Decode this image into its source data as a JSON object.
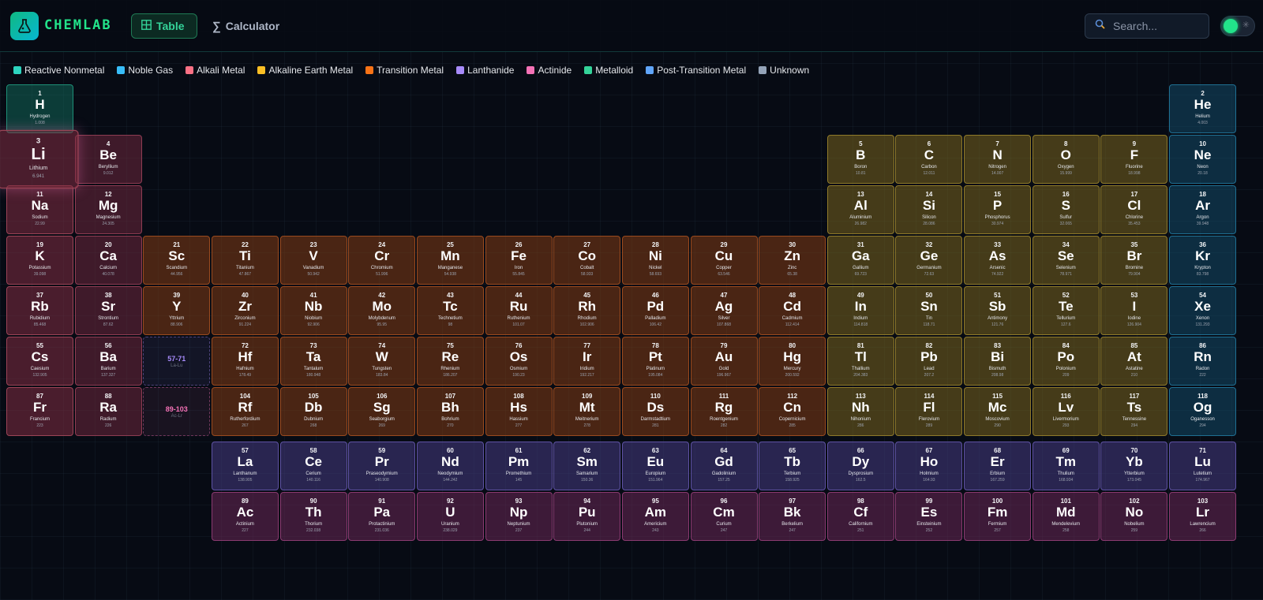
{
  "header": {
    "brand": "CHEMLAB",
    "nav": [
      {
        "label": "Table",
        "icon": "table-grid-icon",
        "active": true
      },
      {
        "label": "Calculator",
        "icon": "sigma-icon",
        "active": false
      }
    ],
    "search": {
      "placeholder": "Search...",
      "value": ""
    },
    "theme_toggle": {
      "state": "on"
    }
  },
  "legend": [
    {
      "label": "Reactive Nonmetal",
      "color": "#2dd4bf"
    },
    {
      "label": "Noble Gas",
      "color": "#38bdf8"
    },
    {
      "label": "Alkali Metal",
      "color": "#fb7185"
    },
    {
      "label": "Alkaline Earth Metal",
      "color": "#fbbf24"
    },
    {
      "label": "Transition Metal",
      "color": "#f97316"
    },
    {
      "label": "Lanthanide",
      "color": "#a78bfa"
    },
    {
      "label": "Actinide",
      "color": "#f472b6"
    },
    {
      "label": "Metalloid",
      "color": "#34d399"
    },
    {
      "label": "Post-Transition Metal",
      "color": "#60a5fa"
    },
    {
      "label": "Unknown",
      "color": "#94a3b8"
    }
  ],
  "selected_element": "Li",
  "placeholders": [
    {
      "range": "57-71",
      "label": "La-Lu",
      "color": "#a78bfa",
      "row": 6,
      "col": 3
    },
    {
      "range": "89-103",
      "label": "Ac-Lr",
      "color": "#f472b6",
      "row": 7,
      "col": 3
    }
  ],
  "elements": [
    {
      "n": 1,
      "s": "H",
      "name": "Hydrogen",
      "w": "1.008",
      "c": "rn",
      "r": 1,
      "col": 1
    },
    {
      "n": 2,
      "s": "He",
      "name": "Helium",
      "w": "4.003",
      "c": "ng",
      "r": 1,
      "col": 18
    },
    {
      "n": 3,
      "s": "Li",
      "name": "Lithium",
      "w": "6.941",
      "c": "am",
      "r": 2,
      "col": 1
    },
    {
      "n": 4,
      "s": "Be",
      "name": "Beryllium",
      "w": "9.012",
      "c": "ae",
      "r": 2,
      "col": 2
    },
    {
      "n": 5,
      "s": "B",
      "name": "Boron",
      "w": "10.81",
      "c": "md",
      "r": 2,
      "col": 13
    },
    {
      "n": 6,
      "s": "C",
      "name": "Carbon",
      "w": "12.011",
      "c": "rn2",
      "r": 2,
      "col": 14
    },
    {
      "n": 7,
      "s": "N",
      "name": "Nitrogen",
      "w": "14.007",
      "c": "rn2",
      "r": 2,
      "col": 15
    },
    {
      "n": 8,
      "s": "O",
      "name": "Oxygen",
      "w": "15.999",
      "c": "rn2",
      "r": 2,
      "col": 16
    },
    {
      "n": 9,
      "s": "F",
      "name": "Fluorine",
      "w": "18.998",
      "c": "rn2",
      "r": 2,
      "col": 17
    },
    {
      "n": 10,
      "s": "Ne",
      "name": "Neon",
      "w": "20.18",
      "c": "ng",
      "r": 2,
      "col": 18
    },
    {
      "n": 11,
      "s": "Na",
      "name": "Sodium",
      "w": "22.99",
      "c": "am",
      "r": 3,
      "col": 1
    },
    {
      "n": 12,
      "s": "Mg",
      "name": "Magnesium",
      "w": "24.305",
      "c": "ae",
      "r": 3,
      "col": 2
    },
    {
      "n": 13,
      "s": "Al",
      "name": "Aluminium",
      "w": "26.982",
      "c": "pt",
      "r": 3,
      "col": 13
    },
    {
      "n": 14,
      "s": "Si",
      "name": "Silicon",
      "w": "28.086",
      "c": "md",
      "r": 3,
      "col": 14
    },
    {
      "n": 15,
      "s": "P",
      "name": "Phosphorus",
      "w": "30.974",
      "c": "rn2",
      "r": 3,
      "col": 15
    },
    {
      "n": 16,
      "s": "S",
      "name": "Sulfur",
      "w": "32.065",
      "c": "rn2",
      "r": 3,
      "col": 16
    },
    {
      "n": 17,
      "s": "Cl",
      "name": "Chlorine",
      "w": "35.453",
      "c": "rn2",
      "r": 3,
      "col": 17
    },
    {
      "n": 18,
      "s": "Ar",
      "name": "Argon",
      "w": "39.948",
      "c": "ng",
      "r": 3,
      "col": 18
    },
    {
      "n": 19,
      "s": "K",
      "name": "Potassium",
      "w": "39.098",
      "c": "am",
      "r": 4,
      "col": 1
    },
    {
      "n": 20,
      "s": "Ca",
      "name": "Calcium",
      "w": "40.078",
      "c": "ae",
      "r": 4,
      "col": 2
    },
    {
      "n": 21,
      "s": "Sc",
      "name": "Scandium",
      "w": "44.956",
      "c": "tm",
      "r": 4,
      "col": 3
    },
    {
      "n": 22,
      "s": "Ti",
      "name": "Titanium",
      "w": "47.867",
      "c": "tm",
      "r": 4,
      "col": 4
    },
    {
      "n": 23,
      "s": "V",
      "name": "Vanadium",
      "w": "50.942",
      "c": "tm",
      "r": 4,
      "col": 5
    },
    {
      "n": 24,
      "s": "Cr",
      "name": "Chromium",
      "w": "51.996",
      "c": "tm",
      "r": 4,
      "col": 6
    },
    {
      "n": 25,
      "s": "Mn",
      "name": "Manganese",
      "w": "54.938",
      "c": "tm",
      "r": 4,
      "col": 7
    },
    {
      "n": 26,
      "s": "Fe",
      "name": "Iron",
      "w": "55.845",
      "c": "tm",
      "r": 4,
      "col": 8
    },
    {
      "n": 27,
      "s": "Co",
      "name": "Cobalt",
      "w": "58.933",
      "c": "tm",
      "r": 4,
      "col": 9
    },
    {
      "n": 28,
      "s": "Ni",
      "name": "Nickel",
      "w": "58.693",
      "c": "tm",
      "r": 4,
      "col": 10
    },
    {
      "n": 29,
      "s": "Cu",
      "name": "Copper",
      "w": "63.546",
      "c": "tm",
      "r": 4,
      "col": 11
    },
    {
      "n": 30,
      "s": "Zn",
      "name": "Zinc",
      "w": "65.38",
      "c": "tm",
      "r": 4,
      "col": 12
    },
    {
      "n": 31,
      "s": "Ga",
      "name": "Gallium",
      "w": "69.723",
      "c": "pt",
      "r": 4,
      "col": 13
    },
    {
      "n": 32,
      "s": "Ge",
      "name": "Germanium",
      "w": "72.63",
      "c": "md",
      "r": 4,
      "col": 14
    },
    {
      "n": 33,
      "s": "As",
      "name": "Arsenic",
      "w": "74.922",
      "c": "md",
      "r": 4,
      "col": 15
    },
    {
      "n": 34,
      "s": "Se",
      "name": "Selenium",
      "w": "78.971",
      "c": "rn2",
      "r": 4,
      "col": 16
    },
    {
      "n": 35,
      "s": "Br",
      "name": "Bromine",
      "w": "79.904",
      "c": "rn2",
      "r": 4,
      "col": 17
    },
    {
      "n": 36,
      "s": "Kr",
      "name": "Krypton",
      "w": "83.798",
      "c": "ng",
      "r": 4,
      "col": 18
    },
    {
      "n": 37,
      "s": "Rb",
      "name": "Rubidium",
      "w": "85.468",
      "c": "am",
      "r": 5,
      "col": 1
    },
    {
      "n": 38,
      "s": "Sr",
      "name": "Strontium",
      "w": "87.62",
      "c": "ae",
      "r": 5,
      "col": 2
    },
    {
      "n": 39,
      "s": "Y",
      "name": "Yttrium",
      "w": "88.906",
      "c": "tm",
      "r": 5,
      "col": 3
    },
    {
      "n": 40,
      "s": "Zr",
      "name": "Zirconium",
      "w": "91.224",
      "c": "tm",
      "r": 5,
      "col": 4
    },
    {
      "n": 41,
      "s": "Nb",
      "name": "Niobium",
      "w": "92.906",
      "c": "tm",
      "r": 5,
      "col": 5
    },
    {
      "n": 42,
      "s": "Mo",
      "name": "Molybdenum",
      "w": "95.95",
      "c": "tm",
      "r": 5,
      "col": 6
    },
    {
      "n": 43,
      "s": "Tc",
      "name": "Technetium",
      "w": "98",
      "c": "tm",
      "r": 5,
      "col": 7
    },
    {
      "n": 44,
      "s": "Ru",
      "name": "Ruthenium",
      "w": "101.07",
      "c": "tm",
      "r": 5,
      "col": 8
    },
    {
      "n": 45,
      "s": "Rh",
      "name": "Rhodium",
      "w": "102.906",
      "c": "tm",
      "r": 5,
      "col": 9
    },
    {
      "n": 46,
      "s": "Pd",
      "name": "Palladium",
      "w": "106.42",
      "c": "tm",
      "r": 5,
      "col": 10
    },
    {
      "n": 47,
      "s": "Ag",
      "name": "Silver",
      "w": "107.868",
      "c": "tm",
      "r": 5,
      "col": 11
    },
    {
      "n": 48,
      "s": "Cd",
      "name": "Cadmium",
      "w": "112.414",
      "c": "tm",
      "r": 5,
      "col": 12
    },
    {
      "n": 49,
      "s": "In",
      "name": "Indium",
      "w": "114.818",
      "c": "pt",
      "r": 5,
      "col": 13
    },
    {
      "n": 50,
      "s": "Sn",
      "name": "Tin",
      "w": "118.71",
      "c": "pt",
      "r": 5,
      "col": 14
    },
    {
      "n": 51,
      "s": "Sb",
      "name": "Antimony",
      "w": "121.76",
      "c": "md",
      "r": 5,
      "col": 15
    },
    {
      "n": 52,
      "s": "Te",
      "name": "Tellurium",
      "w": "127.6",
      "c": "md",
      "r": 5,
      "col": 16
    },
    {
      "n": 53,
      "s": "I",
      "name": "Iodine",
      "w": "126.904",
      "c": "rn2",
      "r": 5,
      "col": 17
    },
    {
      "n": 54,
      "s": "Xe",
      "name": "Xenon",
      "w": "131.293",
      "c": "ng",
      "r": 5,
      "col": 18
    },
    {
      "n": 55,
      "s": "Cs",
      "name": "Caesium",
      "w": "132.905",
      "c": "am",
      "r": 6,
      "col": 1
    },
    {
      "n": 56,
      "s": "Ba",
      "name": "Barium",
      "w": "137.327",
      "c": "ae",
      "r": 6,
      "col": 2
    },
    {
      "n": 72,
      "s": "Hf",
      "name": "Hafnium",
      "w": "178.49",
      "c": "tm",
      "r": 6,
      "col": 4
    },
    {
      "n": 73,
      "s": "Ta",
      "name": "Tantalum",
      "w": "180.948",
      "c": "tm",
      "r": 6,
      "col": 5
    },
    {
      "n": 74,
      "s": "W",
      "name": "Tungsten",
      "w": "183.84",
      "c": "tm",
      "r": 6,
      "col": 6
    },
    {
      "n": 75,
      "s": "Re",
      "name": "Rhenium",
      "w": "186.207",
      "c": "tm",
      "r": 6,
      "col": 7
    },
    {
      "n": 76,
      "s": "Os",
      "name": "Osmium",
      "w": "190.23",
      "c": "tm",
      "r": 6,
      "col": 8
    },
    {
      "n": 77,
      "s": "Ir",
      "name": "Iridium",
      "w": "192.217",
      "c": "tm",
      "r": 6,
      "col": 9
    },
    {
      "n": 78,
      "s": "Pt",
      "name": "Platinum",
      "w": "195.084",
      "c": "tm",
      "r": 6,
      "col": 10
    },
    {
      "n": 79,
      "s": "Au",
      "name": "Gold",
      "w": "196.967",
      "c": "tm",
      "r": 6,
      "col": 11
    },
    {
      "n": 80,
      "s": "Hg",
      "name": "Mercury",
      "w": "200.592",
      "c": "tm",
      "r": 6,
      "col": 12
    },
    {
      "n": 81,
      "s": "Tl",
      "name": "Thallium",
      "w": "204.383",
      "c": "pt",
      "r": 6,
      "col": 13
    },
    {
      "n": 82,
      "s": "Pb",
      "name": "Lead",
      "w": "207.2",
      "c": "pt",
      "r": 6,
      "col": 14
    },
    {
      "n": 83,
      "s": "Bi",
      "name": "Bismuth",
      "w": "208.98",
      "c": "pt",
      "r": 6,
      "col": 15
    },
    {
      "n": 84,
      "s": "Po",
      "name": "Polonium",
      "w": "209",
      "c": "pt",
      "r": 6,
      "col": 16
    },
    {
      "n": 85,
      "s": "At",
      "name": "Astatine",
      "w": "210",
      "c": "md",
      "r": 6,
      "col": 17
    },
    {
      "n": 86,
      "s": "Rn",
      "name": "Radon",
      "w": "222",
      "c": "ng",
      "r": 6,
      "col": 18
    },
    {
      "n": 87,
      "s": "Fr",
      "name": "Francium",
      "w": "223",
      "c": "am",
      "r": 7,
      "col": 1
    },
    {
      "n": 88,
      "s": "Ra",
      "name": "Radium",
      "w": "226",
      "c": "ae",
      "r": 7,
      "col": 2
    },
    {
      "n": 104,
      "s": "Rf",
      "name": "Rutherfordium",
      "w": "267",
      "c": "tm",
      "r": 7,
      "col": 4
    },
    {
      "n": 105,
      "s": "Db",
      "name": "Dubnium",
      "w": "268",
      "c": "tm",
      "r": 7,
      "col": 5
    },
    {
      "n": 106,
      "s": "Sg",
      "name": "Seaborgium",
      "w": "269",
      "c": "tm",
      "r": 7,
      "col": 6
    },
    {
      "n": 107,
      "s": "Bh",
      "name": "Bohrium",
      "w": "270",
      "c": "tm",
      "r": 7,
      "col": 7
    },
    {
      "n": 108,
      "s": "Hs",
      "name": "Hassium",
      "w": "277",
      "c": "tm",
      "r": 7,
      "col": 8
    },
    {
      "n": 109,
      "s": "Mt",
      "name": "Meitnerium",
      "w": "278",
      "c": "tm",
      "r": 7,
      "col": 9
    },
    {
      "n": 110,
      "s": "Ds",
      "name": "Darmstadtium",
      "w": "281",
      "c": "tm",
      "r": 7,
      "col": 10
    },
    {
      "n": 111,
      "s": "Rg",
      "name": "Roentgenium",
      "w": "282",
      "c": "tm",
      "r": 7,
      "col": 11
    },
    {
      "n": 112,
      "s": "Cn",
      "name": "Copernicium",
      "w": "285",
      "c": "tm",
      "r": 7,
      "col": 12
    },
    {
      "n": 113,
      "s": "Nh",
      "name": "Nihonium",
      "w": "286",
      "c": "pt",
      "r": 7,
      "col": 13
    },
    {
      "n": 114,
      "s": "Fl",
      "name": "Flerovium",
      "w": "289",
      "c": "pt",
      "r": 7,
      "col": 14
    },
    {
      "n": 115,
      "s": "Mc",
      "name": "Moscovium",
      "w": "290",
      "c": "pt",
      "r": 7,
      "col": 15
    },
    {
      "n": 116,
      "s": "Lv",
      "name": "Livermorium",
      "w": "293",
      "c": "pt",
      "r": 7,
      "col": 16
    },
    {
      "n": 117,
      "s": "Ts",
      "name": "Tennessine",
      "w": "294",
      "c": "md",
      "r": 7,
      "col": 17
    },
    {
      "n": 118,
      "s": "Og",
      "name": "Oganesson",
      "w": "294",
      "c": "ng",
      "r": 7,
      "col": 18
    },
    {
      "n": 57,
      "s": "La",
      "name": "Lanthanum",
      "w": "138.905",
      "c": "ln",
      "r": 9,
      "col": 4
    },
    {
      "n": 58,
      "s": "Ce",
      "name": "Cerium",
      "w": "140.116",
      "c": "ln",
      "r": 9,
      "col": 5
    },
    {
      "n": 59,
      "s": "Pr",
      "name": "Praseodymium",
      "w": "140.908",
      "c": "ln",
      "r": 9,
      "col": 6
    },
    {
      "n": 60,
      "s": "Nd",
      "name": "Neodymium",
      "w": "144.242",
      "c": "ln",
      "r": 9,
      "col": 7
    },
    {
      "n": 61,
      "s": "Pm",
      "name": "Promethium",
      "w": "145",
      "c": "ln",
      "r": 9,
      "col": 8
    },
    {
      "n": 62,
      "s": "Sm",
      "name": "Samarium",
      "w": "150.36",
      "c": "ln",
      "r": 9,
      "col": 9
    },
    {
      "n": 63,
      "s": "Eu",
      "name": "Europium",
      "w": "151.964",
      "c": "ln",
      "r": 9,
      "col": 10
    },
    {
      "n": 64,
      "s": "Gd",
      "name": "Gadolinium",
      "w": "157.25",
      "c": "ln",
      "r": 9,
      "col": 11
    },
    {
      "n": 65,
      "s": "Tb",
      "name": "Terbium",
      "w": "158.925",
      "c": "ln",
      "r": 9,
      "col": 12
    },
    {
      "n": 66,
      "s": "Dy",
      "name": "Dysprosium",
      "w": "162.5",
      "c": "ln",
      "r": 9,
      "col": 13
    },
    {
      "n": 67,
      "s": "Ho",
      "name": "Holmium",
      "w": "164.93",
      "c": "ln",
      "r": 9,
      "col": 14
    },
    {
      "n": 68,
      "s": "Er",
      "name": "Erbium",
      "w": "167.259",
      "c": "ln",
      "r": 9,
      "col": 15
    },
    {
      "n": 69,
      "s": "Tm",
      "name": "Thulium",
      "w": "168.934",
      "c": "ln",
      "r": 9,
      "col": 16
    },
    {
      "n": 70,
      "s": "Yb",
      "name": "Ytterbium",
      "w": "173.045",
      "c": "ln",
      "r": 9,
      "col": 17
    },
    {
      "n": 71,
      "s": "Lu",
      "name": "Lutetium",
      "w": "174.967",
      "c": "ln",
      "r": 9,
      "col": 18
    },
    {
      "n": 89,
      "s": "Ac",
      "name": "Actinium",
      "w": "227",
      "c": "ac",
      "r": 10,
      "col": 4
    },
    {
      "n": 90,
      "s": "Th",
      "name": "Thorium",
      "w": "232.038",
      "c": "ac",
      "r": 10,
      "col": 5
    },
    {
      "n": 91,
      "s": "Pa",
      "name": "Protactinium",
      "w": "231.036",
      "c": "ac",
      "r": 10,
      "col": 6
    },
    {
      "n": 92,
      "s": "U",
      "name": "Uranium",
      "w": "238.029",
      "c": "ac",
      "r": 10,
      "col": 7
    },
    {
      "n": 93,
      "s": "Np",
      "name": "Neptunium",
      "w": "237",
      "c": "ac",
      "r": 10,
      "col": 8
    },
    {
      "n": 94,
      "s": "Pu",
      "name": "Plutonium",
      "w": "244",
      "c": "ac",
      "r": 10,
      "col": 9
    },
    {
      "n": 95,
      "s": "Am",
      "name": "Americium",
      "w": "243",
      "c": "ac",
      "r": 10,
      "col": 10
    },
    {
      "n": 96,
      "s": "Cm",
      "name": "Curium",
      "w": "247",
      "c": "ac",
      "r": 10,
      "col": 11
    },
    {
      "n": 97,
      "s": "Bk",
      "name": "Berkelium",
      "w": "247",
      "c": "ac",
      "r": 10,
      "col": 12
    },
    {
      "n": 98,
      "s": "Cf",
      "name": "Californium",
      "w": "251",
      "c": "ac",
      "r": 10,
      "col": 13
    },
    {
      "n": 99,
      "s": "Es",
      "name": "Einsteinium",
      "w": "252",
      "c": "ac",
      "r": 10,
      "col": 14
    },
    {
      "n": 100,
      "s": "Fm",
      "name": "Fermium",
      "w": "257",
      "c": "ac",
      "r": 10,
      "col": 15
    },
    {
      "n": 101,
      "s": "Md",
      "name": "Mendelevium",
      "w": "258",
      "c": "ac",
      "r": 10,
      "col": 16
    },
    {
      "n": 102,
      "s": "No",
      "name": "Nobelium",
      "w": "259",
      "c": "ac",
      "r": 10,
      "col": 17
    },
    {
      "n": 103,
      "s": "Lr",
      "name": "Lawrencium",
      "w": "266",
      "c": "ac",
      "r": 10,
      "col": 18
    }
  ]
}
